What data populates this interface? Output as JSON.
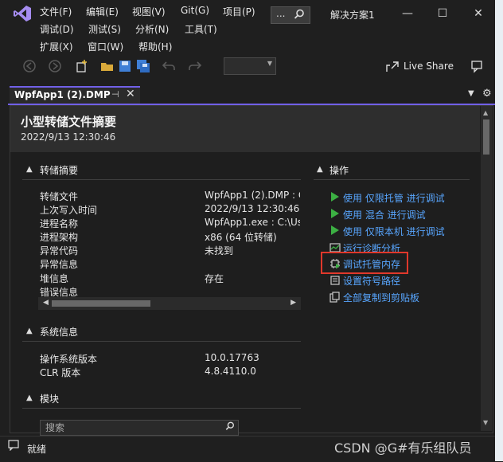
{
  "menu": {
    "row1": [
      "文件(F)",
      "编辑(E)",
      "视图(V)",
      "Git(G)",
      "项目(P)"
    ],
    "row2": [
      "调试(D)",
      "测试(S)",
      "分析(N)",
      "工具(T)"
    ],
    "row3": [
      "扩展(X)",
      "窗口(W)",
      "帮助(H)"
    ],
    "search_dots": "..."
  },
  "window": {
    "solution_title": "解决方案1",
    "minimize": "—",
    "maximize": "☐",
    "close": "✕"
  },
  "toolbar": {
    "live_share": "Live Share"
  },
  "tab": {
    "label": "WpfApp1 (2).DMP",
    "pin": "⊣",
    "close": "✕"
  },
  "document": {
    "title": "小型转储文件摘要",
    "date": "2022/9/13 12:30:46"
  },
  "dump_summary": {
    "heading": "转储摘要",
    "rows": [
      {
        "label": "转储文件",
        "value": "WpfApp1 (2).DMP : C"
      },
      {
        "label": "上次写入时间",
        "value": "2022/9/13 12:30:46"
      },
      {
        "label": "进程名称",
        "value": "WpfApp1.exe : C:\\Us"
      },
      {
        "label": "进程架构",
        "value": "x86 (64 位转储)"
      },
      {
        "label": "异常代码",
        "value": "未找到"
      },
      {
        "label": "异常信息",
        "value": ""
      },
      {
        "label": "堆信息",
        "value": "存在"
      },
      {
        "label": "错误信息",
        "value": ""
      }
    ]
  },
  "actions": {
    "heading": "操作",
    "items": [
      {
        "text": "使用 仅限托管 进行调试",
        "icon": "play-icon"
      },
      {
        "text": "使用 混合 进行调试",
        "icon": "play-icon"
      },
      {
        "text": "使用 仅限本机 进行调试",
        "icon": "play-icon"
      },
      {
        "text": "运行诊断分析",
        "icon": "diagnostics-icon"
      },
      {
        "text": "调试托管内存",
        "icon": "memory-icon"
      },
      {
        "text": "设置符号路径",
        "icon": "symbol-path-icon"
      },
      {
        "text": "全部复制到剪贴板",
        "icon": "copy-icon"
      }
    ]
  },
  "system_info": {
    "heading": "系统信息",
    "rows": [
      {
        "label": "操作系统版本",
        "value": "10.0.17763"
      },
      {
        "label": "CLR 版本",
        "value": "4.8.4110.0"
      }
    ]
  },
  "modules": {
    "heading": "模块",
    "search_placeholder": "搜索"
  },
  "status": {
    "text": "就绪",
    "watermark": "CSDN @G#有乐组队员"
  },
  "colors": {
    "accent": "#7160e8",
    "link": "#58a6ff",
    "highlight": "#e0382b",
    "play": "#3cb043"
  }
}
